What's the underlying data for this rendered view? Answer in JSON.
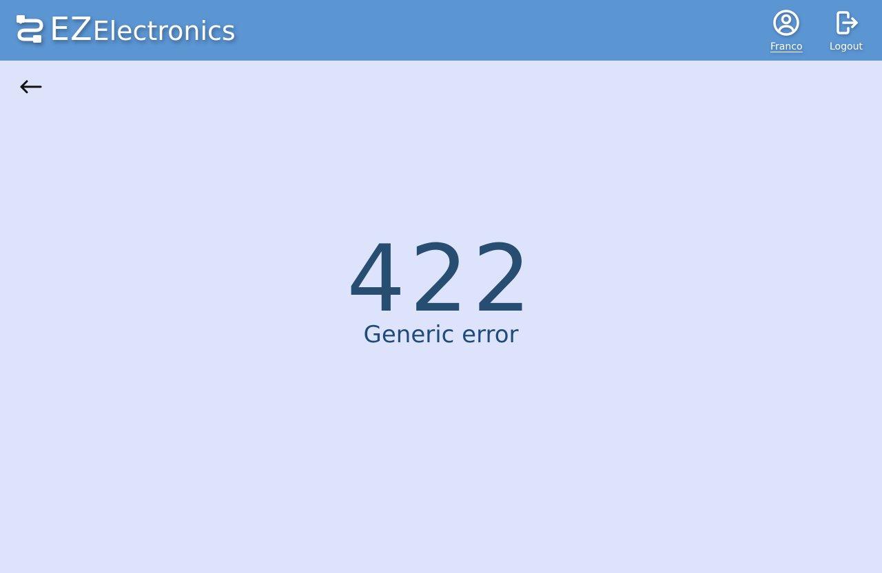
{
  "header": {
    "brand_short": "EZ",
    "brand_rest": "Electronics",
    "logo_icon": "route-icon",
    "background_color": "#5b95d2"
  },
  "nav": {
    "profile": {
      "label": "Franco",
      "icon": "user-circle-icon"
    },
    "logout": {
      "label": "Logout",
      "icon": "logout-icon"
    }
  },
  "back": {
    "icon": "arrow-left-icon"
  },
  "error": {
    "code": "422",
    "message": "Generic error",
    "code_color": "#274d71",
    "message_color": "#1f4b7a"
  },
  "page": {
    "background_color": "#dee3fc"
  }
}
